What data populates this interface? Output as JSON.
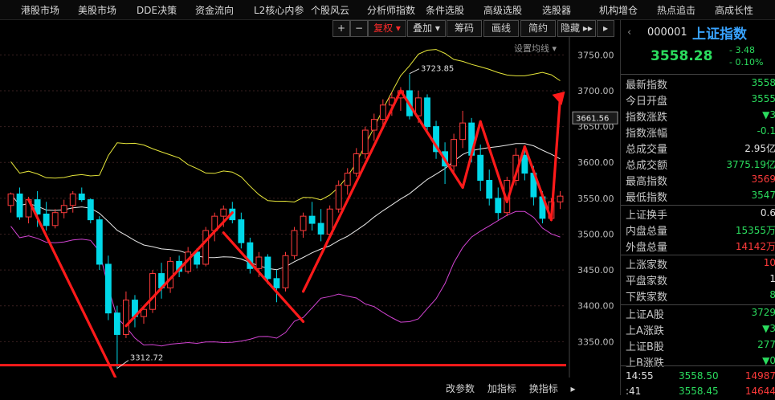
{
  "nav": {
    "items": [
      {
        "label": "港股市场"
      },
      {
        "label": "美股市场"
      },
      {
        "label": "DDE决策"
      },
      {
        "label": "资金流向"
      },
      {
        "label": "L2核心内参"
      },
      {
        "label": "个股风云"
      },
      {
        "label": "分析师指数"
      },
      {
        "label": "条件选股"
      },
      {
        "label": "高级选股"
      },
      {
        "label": "选股器"
      },
      {
        "label": "机构增仓"
      },
      {
        "label": "热点追击"
      },
      {
        "label": "高成长性"
      }
    ]
  },
  "toolbar": {
    "plus": "+",
    "minus": "−",
    "fuquan": "复权",
    "addsub": "叠加",
    "chouma": "筹码",
    "huaxian": "画线",
    "jianyue": "简约",
    "yincang": "隐藏"
  },
  "chart": {
    "ma_setting": "设置均线",
    "high_label": "3723.85",
    "low_label": "3312.72",
    "current_tag": "3661.56",
    "yticks": [
      "3750.00",
      "3700.00",
      "3650.00",
      "3600.00",
      "3550.00",
      "3500.00",
      "3450.00",
      "3400.00",
      "3350.00"
    ]
  },
  "chart_data": {
    "type": "candlestick",
    "yaxis_ticks": [
      3750,
      3700,
      3650,
      3600,
      3550,
      3500,
      3450,
      3400,
      3350
    ],
    "ylim": [
      3300,
      3775
    ],
    "annotations": {
      "high": 3723.85,
      "low": 3312.72,
      "last": 3661.56
    },
    "candles": [
      {
        "o": 3540,
        "h": 3558,
        "l": 3530,
        "c": 3556
      },
      {
        "o": 3556,
        "h": 3565,
        "l": 3520,
        "c": 3524
      },
      {
        "o": 3524,
        "h": 3552,
        "l": 3515,
        "c": 3548
      },
      {
        "o": 3548,
        "h": 3560,
        "l": 3510,
        "c": 3528
      },
      {
        "o": 3528,
        "h": 3545,
        "l": 3505,
        "c": 3512
      },
      {
        "o": 3512,
        "h": 3535,
        "l": 3508,
        "c": 3530
      },
      {
        "o": 3530,
        "h": 3548,
        "l": 3522,
        "c": 3540
      },
      {
        "o": 3540,
        "h": 3560,
        "l": 3530,
        "c": 3556
      },
      {
        "o": 3556,
        "h": 3565,
        "l": 3545,
        "c": 3548
      },
      {
        "o": 3548,
        "h": 3550,
        "l": 3515,
        "c": 3520
      },
      {
        "o": 3520,
        "h": 3525,
        "l": 3450,
        "c": 3458
      },
      {
        "o": 3458,
        "h": 3470,
        "l": 3380,
        "c": 3390
      },
      {
        "o": 3390,
        "h": 3400,
        "l": 3312,
        "c": 3360
      },
      {
        "o": 3360,
        "h": 3420,
        "l": 3355,
        "c": 3408
      },
      {
        "o": 3408,
        "h": 3415,
        "l": 3370,
        "c": 3385
      },
      {
        "o": 3385,
        "h": 3400,
        "l": 3375,
        "c": 3395
      },
      {
        "o": 3395,
        "h": 3450,
        "l": 3390,
        "c": 3445
      },
      {
        "o": 3445,
        "h": 3460,
        "l": 3410,
        "c": 3425
      },
      {
        "o": 3425,
        "h": 3468,
        "l": 3418,
        "c": 3462
      },
      {
        "o": 3462,
        "h": 3470,
        "l": 3440,
        "c": 3448
      },
      {
        "o": 3448,
        "h": 3482,
        "l": 3445,
        "c": 3475
      },
      {
        "o": 3475,
        "h": 3480,
        "l": 3452,
        "c": 3458
      },
      {
        "o": 3458,
        "h": 3510,
        "l": 3455,
        "c": 3505
      },
      {
        "o": 3505,
        "h": 3530,
        "l": 3490,
        "c": 3525
      },
      {
        "o": 3525,
        "h": 3540,
        "l": 3510,
        "c": 3535
      },
      {
        "o": 3535,
        "h": 3545,
        "l": 3515,
        "c": 3520
      },
      {
        "o": 3520,
        "h": 3530,
        "l": 3480,
        "c": 3488
      },
      {
        "o": 3488,
        "h": 3495,
        "l": 3445,
        "c": 3452
      },
      {
        "o": 3452,
        "h": 3475,
        "l": 3440,
        "c": 3468
      },
      {
        "o": 3468,
        "h": 3472,
        "l": 3430,
        "c": 3438
      },
      {
        "o": 3438,
        "h": 3450,
        "l": 3405,
        "c": 3425
      },
      {
        "o": 3425,
        "h": 3475,
        "l": 3420,
        "c": 3470
      },
      {
        "o": 3470,
        "h": 3510,
        "l": 3465,
        "c": 3505
      },
      {
        "o": 3505,
        "h": 3530,
        "l": 3495,
        "c": 3525
      },
      {
        "o": 3525,
        "h": 3545,
        "l": 3505,
        "c": 3515
      },
      {
        "o": 3515,
        "h": 3535,
        "l": 3490,
        "c": 3500
      },
      {
        "o": 3500,
        "h": 3540,
        "l": 3495,
        "c": 3535
      },
      {
        "o": 3535,
        "h": 3575,
        "l": 3530,
        "c": 3568
      },
      {
        "o": 3568,
        "h": 3592,
        "l": 3555,
        "c": 3585
      },
      {
        "o": 3585,
        "h": 3620,
        "l": 3580,
        "c": 3612
      },
      {
        "o": 3612,
        "h": 3650,
        "l": 3605,
        "c": 3645
      },
      {
        "o": 3645,
        "h": 3668,
        "l": 3630,
        "c": 3660
      },
      {
        "o": 3660,
        "h": 3688,
        "l": 3650,
        "c": 3680
      },
      {
        "o": 3680,
        "h": 3698,
        "l": 3665,
        "c": 3690
      },
      {
        "o": 3690,
        "h": 3705,
        "l": 3672,
        "c": 3700
      },
      {
        "o": 3700,
        "h": 3723,
        "l": 3660,
        "c": 3665
      },
      {
        "o": 3665,
        "h": 3700,
        "l": 3655,
        "c": 3690
      },
      {
        "o": 3690,
        "h": 3695,
        "l": 3640,
        "c": 3650
      },
      {
        "o": 3650,
        "h": 3658,
        "l": 3605,
        "c": 3615
      },
      {
        "o": 3615,
        "h": 3628,
        "l": 3570,
        "c": 3595
      },
      {
        "o": 3595,
        "h": 3640,
        "l": 3585,
        "c": 3632
      },
      {
        "o": 3632,
        "h": 3672,
        "l": 3620,
        "c": 3655
      },
      {
        "o": 3655,
        "h": 3662,
        "l": 3600,
        "c": 3610
      },
      {
        "o": 3610,
        "h": 3625,
        "l": 3560,
        "c": 3575
      },
      {
        "o": 3575,
        "h": 3590,
        "l": 3540,
        "c": 3550
      },
      {
        "o": 3550,
        "h": 3565,
        "l": 3520,
        "c": 3530
      },
      {
        "o": 3530,
        "h": 3580,
        "l": 3525,
        "c": 3575
      },
      {
        "o": 3575,
        "h": 3620,
        "l": 3568,
        "c": 3610
      },
      {
        "o": 3610,
        "h": 3618,
        "l": 3575,
        "c": 3585
      },
      {
        "o": 3585,
        "h": 3595,
        "l": 3540,
        "c": 3552
      },
      {
        "o": 3552,
        "h": 3560,
        "l": 3515,
        "c": 3522
      },
      {
        "o": 3522,
        "h": 3550,
        "l": 3518,
        "c": 3545
      },
      {
        "o": 3545,
        "h": 3560,
        "l": 3535,
        "c": 3553
      }
    ]
  },
  "bottom": {
    "gai_canshu": "改参数",
    "jia_zhibiao": "加指标",
    "huan_zhibiao": "换指标"
  },
  "quote": {
    "code": "000001",
    "name": "上证指数",
    "price": "3558.28",
    "change": "- 3.48",
    "pct": "- 0.10%",
    "rows": [
      {
        "label": "最新指数",
        "value": "3558",
        "color": "#2bdc5e"
      },
      {
        "label": "今日开盘",
        "value": "3555",
        "color": "#2bdc5e"
      },
      {
        "label": "指数涨跌",
        "value": "▼3",
        "color": "#2bdc5e"
      },
      {
        "label": "指数涨幅",
        "value": "-0.1",
        "color": "#2bdc5e"
      },
      {
        "label": "总成交量",
        "value": "2.95亿",
        "color": "#e0e0e0"
      },
      {
        "label": "总成交额",
        "value": "3775.19亿",
        "color": "#2bdc5e"
      },
      {
        "label": "最高指数",
        "value": "3569",
        "color": "#ff3b3b"
      },
      {
        "label": "最低指数",
        "value": "3547",
        "color": "#2bdc5e"
      },
      {
        "label": "上证换手",
        "value": "0.6",
        "color": "#e0e0e0"
      },
      {
        "label": "内盘总量",
        "value": "15355万",
        "color": "#2bdc5e"
      },
      {
        "label": "外盘总量",
        "value": "14142万",
        "color": "#ff3b3b"
      },
      {
        "label": "上涨家数",
        "value": "10",
        "color": "#ff3b3b"
      },
      {
        "label": "平盘家数",
        "value": "1",
        "color": "#e0e0e0"
      },
      {
        "label": "下跌家数",
        "value": "8",
        "color": "#2bdc5e"
      },
      {
        "label": "上证A股",
        "value": "3729",
        "color": "#2bdc5e"
      },
      {
        "label": "上A涨跌",
        "value": "▼3",
        "color": "#2bdc5e"
      },
      {
        "label": "上证B股",
        "value": "277",
        "color": "#2bdc5e"
      },
      {
        "label": "上B涨跌",
        "value": "▼0",
        "color": "#2bdc5e"
      }
    ],
    "ticks": [
      {
        "time": "14:55",
        "price": "3558.50",
        "vol": "14987"
      },
      {
        "time": ":41",
        "price": "3558.45",
        "vol": "14644"
      }
    ]
  },
  "colors": {
    "up": "#ff3b3b",
    "down": "#00d8e8",
    "ma_white": "#e8e8e8",
    "boll_upper": "#e6e63a",
    "boll_lower": "#d243d2",
    "trend": "#ff1a1a"
  }
}
